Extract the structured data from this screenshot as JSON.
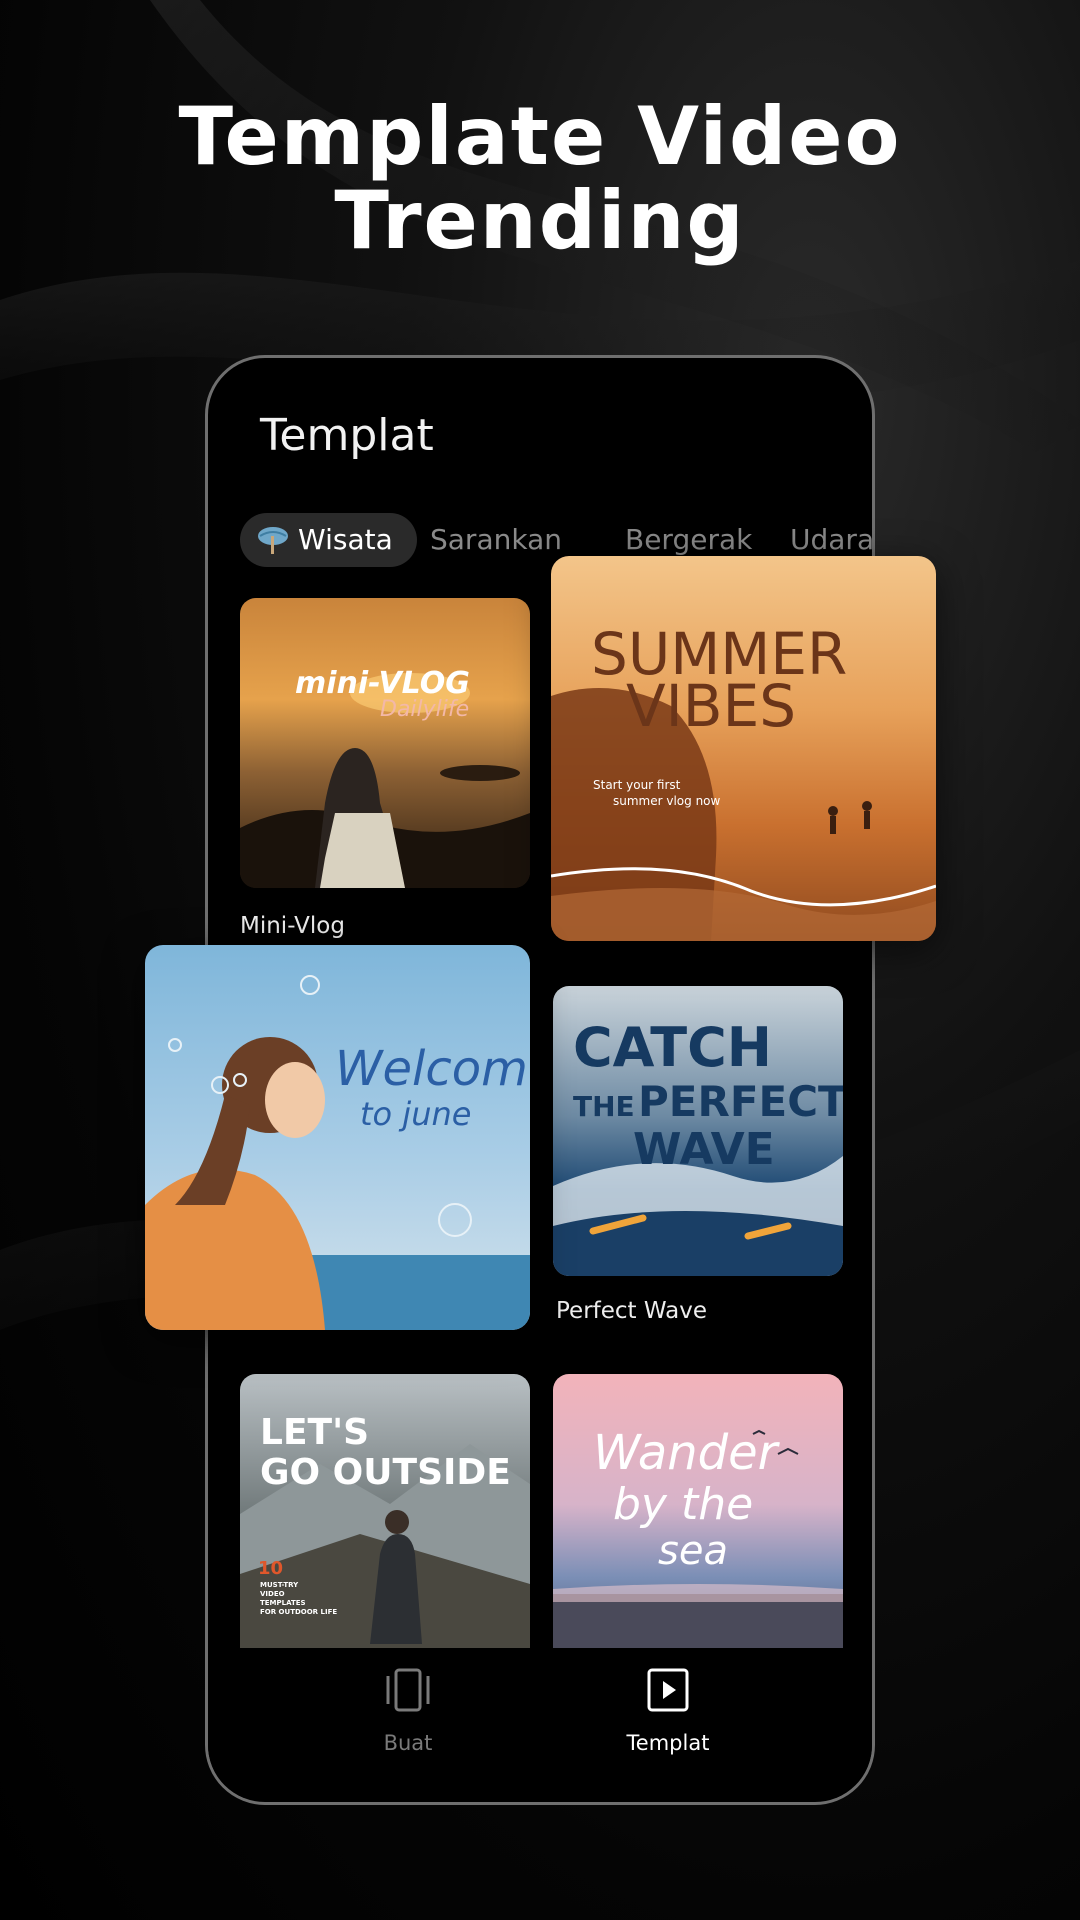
{
  "headline": {
    "line1": "Template Video",
    "line2": "Trending"
  },
  "screen": {
    "title": "Templat",
    "tabs": [
      {
        "label": "Wisata",
        "active": true,
        "icon": "travel-icon"
      },
      {
        "label": "Sarankan",
        "active": false
      },
      {
        "label": "Bergerak",
        "active": false
      },
      {
        "label": "Udara",
        "active": false
      }
    ],
    "cards": [
      {
        "caption": "Mini-Vlog",
        "art_lines": [
          "mini-VLOG",
          "Dailylife"
        ]
      },
      {
        "art_lines": [
          "SUMMER",
          "VIBES",
          "Start your first",
          "summer vlog now"
        ]
      },
      {
        "art_lines": [
          "Welcome",
          "to june"
        ]
      },
      {
        "caption": "Perfect Wave",
        "art_lines": [
          "CATCH",
          "THE",
          "PERFECT",
          "WAVE"
        ]
      },
      {
        "art_lines": [
          "LET'S",
          "GO OUTSIDE",
          "10",
          "MUST-TRY",
          "VIDEO",
          "TEMPLATES",
          "FOR OUTDOOR LIFE"
        ]
      },
      {
        "art_lines": [
          "Wander",
          "by the",
          "sea"
        ]
      }
    ],
    "nav": [
      {
        "label": "Buat",
        "icon": "create-icon",
        "active": false
      },
      {
        "label": "Templat",
        "icon": "play-template-icon",
        "active": true
      }
    ]
  },
  "colors": {
    "background": "#000000",
    "phone_border": "#6f6f6f",
    "tab_active_bg": "#2a2a2a",
    "inactive_text": "#8a8a8a"
  }
}
